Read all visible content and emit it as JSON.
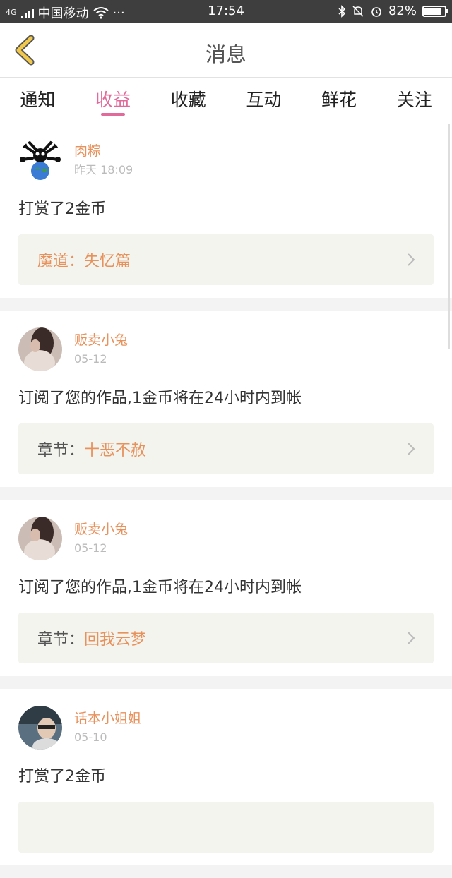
{
  "status_bar": {
    "network": "4G",
    "carrier": "中国移动",
    "more": "···",
    "time": "17:54",
    "battery": "82%",
    "battery_level": 0.82
  },
  "header": {
    "title": "消息"
  },
  "tabs": [
    {
      "label": "通知"
    },
    {
      "label": "收益"
    },
    {
      "label": "收藏"
    },
    {
      "label": "互动"
    },
    {
      "label": "鲜花"
    },
    {
      "label": "关注"
    }
  ],
  "active_tab": "收益",
  "messages": [
    {
      "user": "肉粽",
      "time": "昨天 18:09",
      "text": "打赏了2金币",
      "work_prefix": "魔道：",
      "work_title": "失忆篇",
      "avatar": "panda-globe"
    },
    {
      "user": "贩卖小兔",
      "time": "05-12",
      "text": "订阅了您的作品,1金币将在24小时内到帐",
      "work_prefix": "章节：",
      "work_title": "十恶不赦",
      "avatar": "girl"
    },
    {
      "user": "贩卖小兔",
      "time": "05-12",
      "text": "订阅了您的作品,1金币将在24小时内到帐",
      "work_prefix": "章节：",
      "work_title": "回我云梦",
      "avatar": "girl"
    },
    {
      "user": "话本小姐姐",
      "time": "05-10",
      "text": "打赏了2金币",
      "work_prefix": "",
      "work_title": "",
      "avatar": "car-man"
    }
  ],
  "colors": {
    "accent_pink": "#e26a9a",
    "accent_orange": "#e7925d",
    "back_yellow": "#f2c84b"
  }
}
